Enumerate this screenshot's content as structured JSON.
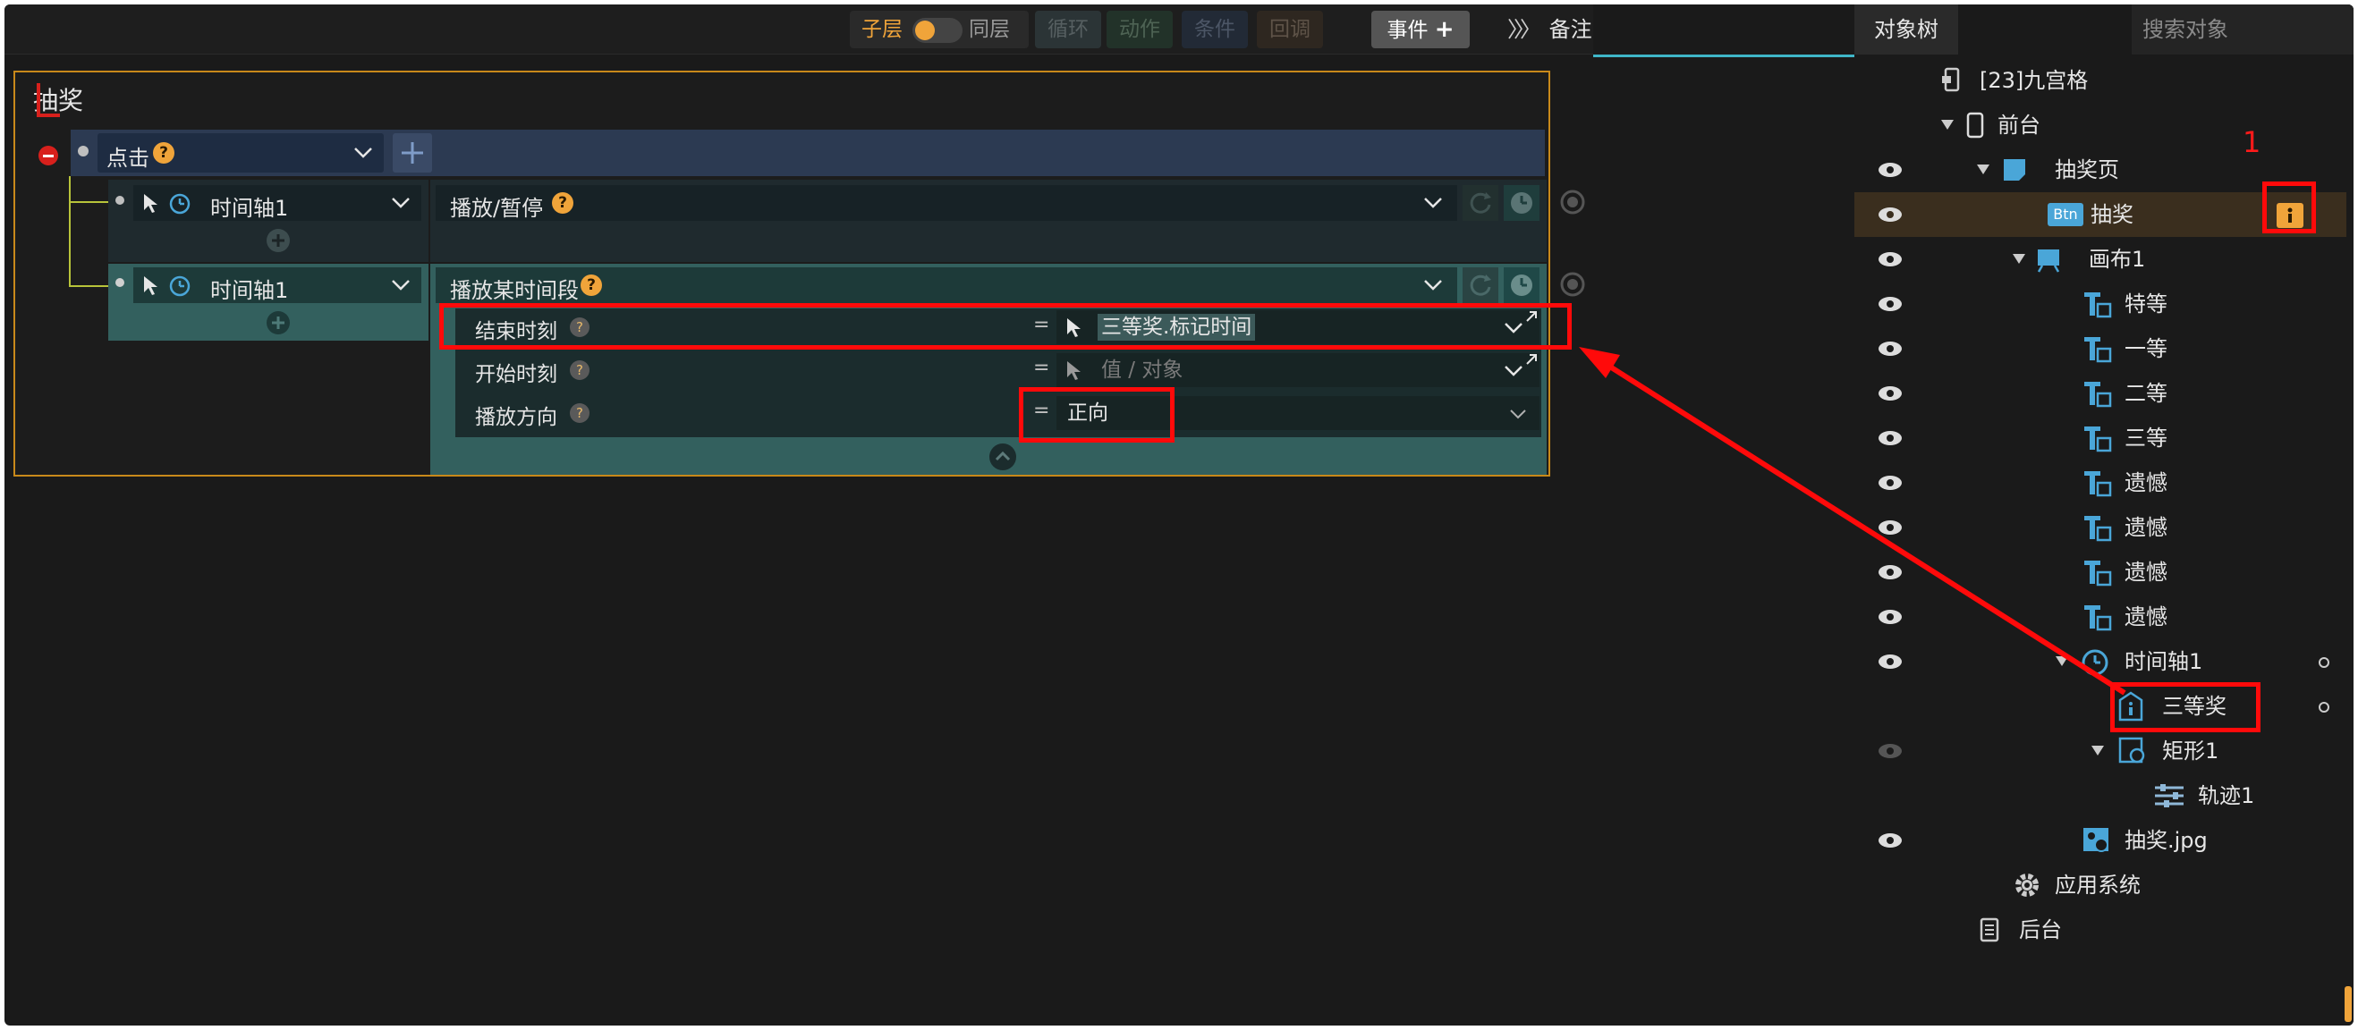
{
  "toolbar": {
    "child_layer": "子层",
    "same_layer": "同层",
    "loop": "循环",
    "action": "动作",
    "condition": "条件",
    "callback": "回调",
    "event": "事件",
    "notes": "备注"
  },
  "event_card": {
    "title": "抽奖",
    "trigger": "点击",
    "rows": [
      {
        "target": "时间轴1",
        "action": "播放/暂停"
      },
      {
        "target": "时间轴1",
        "action": "播放某时间段"
      }
    ],
    "params": [
      {
        "label": "结束时刻",
        "eq": "=",
        "value": "三等奖.标记时间"
      },
      {
        "label": "开始时刻",
        "eq": "=",
        "placeholder": "值 / 对象"
      },
      {
        "label": "播放方向",
        "eq": "=",
        "value": "正向"
      }
    ]
  },
  "panel": {
    "tab_tree": "对象树",
    "search_placeholder": "搜索对象",
    "annotation_number": "1",
    "btn_badge": "Btn",
    "items": [
      "[23]九宫格",
      "前台",
      "抽奖页",
      "抽奖",
      "画布1",
      "特等",
      "一等",
      "二等",
      "三等",
      "遗憾",
      "遗憾",
      "遗憾",
      "遗憾",
      "时间轴1",
      "三等奖",
      "矩形1",
      "轨迹1",
      "抽奖.jpg",
      "应用系统",
      "后台"
    ]
  },
  "colors": {
    "accent_orange": "#f0a43a",
    "highlight_red": "#ff0a0a",
    "icon_blue": "#4aa6d8",
    "card_border": "#c8891a"
  }
}
